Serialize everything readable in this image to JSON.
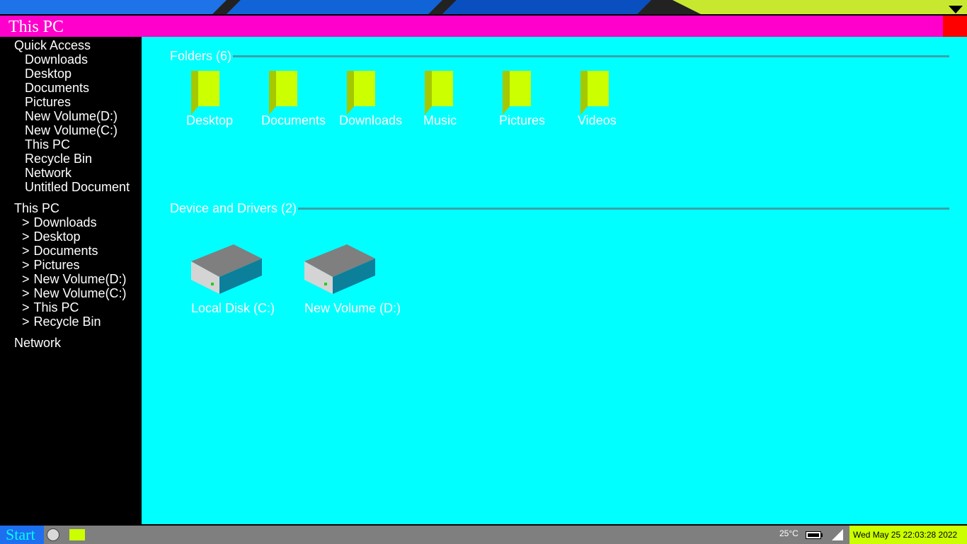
{
  "colors": {
    "title_bar": "#ff00cc",
    "close_button": "#ff0000",
    "sidebar_bg": "#000000",
    "content_bg": "#00ffff",
    "folder": "#ccff00",
    "taskbar": "#7f7f7f",
    "start_button": "#1e6ef0",
    "clock_bg": "#ccff00"
  },
  "window": {
    "title": "This PC"
  },
  "sidebar": {
    "quick_access_title": "Quick Access",
    "quick_access_items": [
      "Downloads",
      "Desktop",
      "Documents",
      "Pictures",
      "New Volume(D:)",
      "New Volume(C:)",
      "This PC",
      "Recycle Bin",
      "Network",
      "Untitled Document"
    ],
    "this_pc_title": "This PC",
    "tree_arrow": ">",
    "this_pc_items": [
      "Downloads",
      "Desktop",
      "Documents",
      "Pictures",
      "New Volume(D:)",
      "New Volume(C:)",
      "This PC",
      "Recycle Bin"
    ],
    "network_title": "Network"
  },
  "main": {
    "folders_header": "Folders (6)",
    "folders": [
      {
        "label": "Desktop",
        "icon": "folder-icon"
      },
      {
        "label": "Documents",
        "icon": "folder-icon"
      },
      {
        "label": "Downloads",
        "icon": "folder-icon"
      },
      {
        "label": "Music",
        "icon": "folder-icon"
      },
      {
        "label": "Pictures",
        "icon": "folder-icon"
      },
      {
        "label": "Videos",
        "icon": "folder-icon"
      }
    ],
    "drives_header": "Device and Drivers (2)",
    "drives": [
      {
        "label": "Local Disk (C:)",
        "icon": "hard-drive-icon"
      },
      {
        "label": "New Volume (D:)",
        "icon": "hard-drive-icon"
      }
    ]
  },
  "taskbar": {
    "start_label": "Start",
    "temperature": "25°C",
    "clock": "Wed May 25 22:03:28 2022",
    "icons": [
      "search-circle-icon",
      "file-explorer-icon",
      "battery-icon",
      "wifi-signal-icon"
    ]
  }
}
